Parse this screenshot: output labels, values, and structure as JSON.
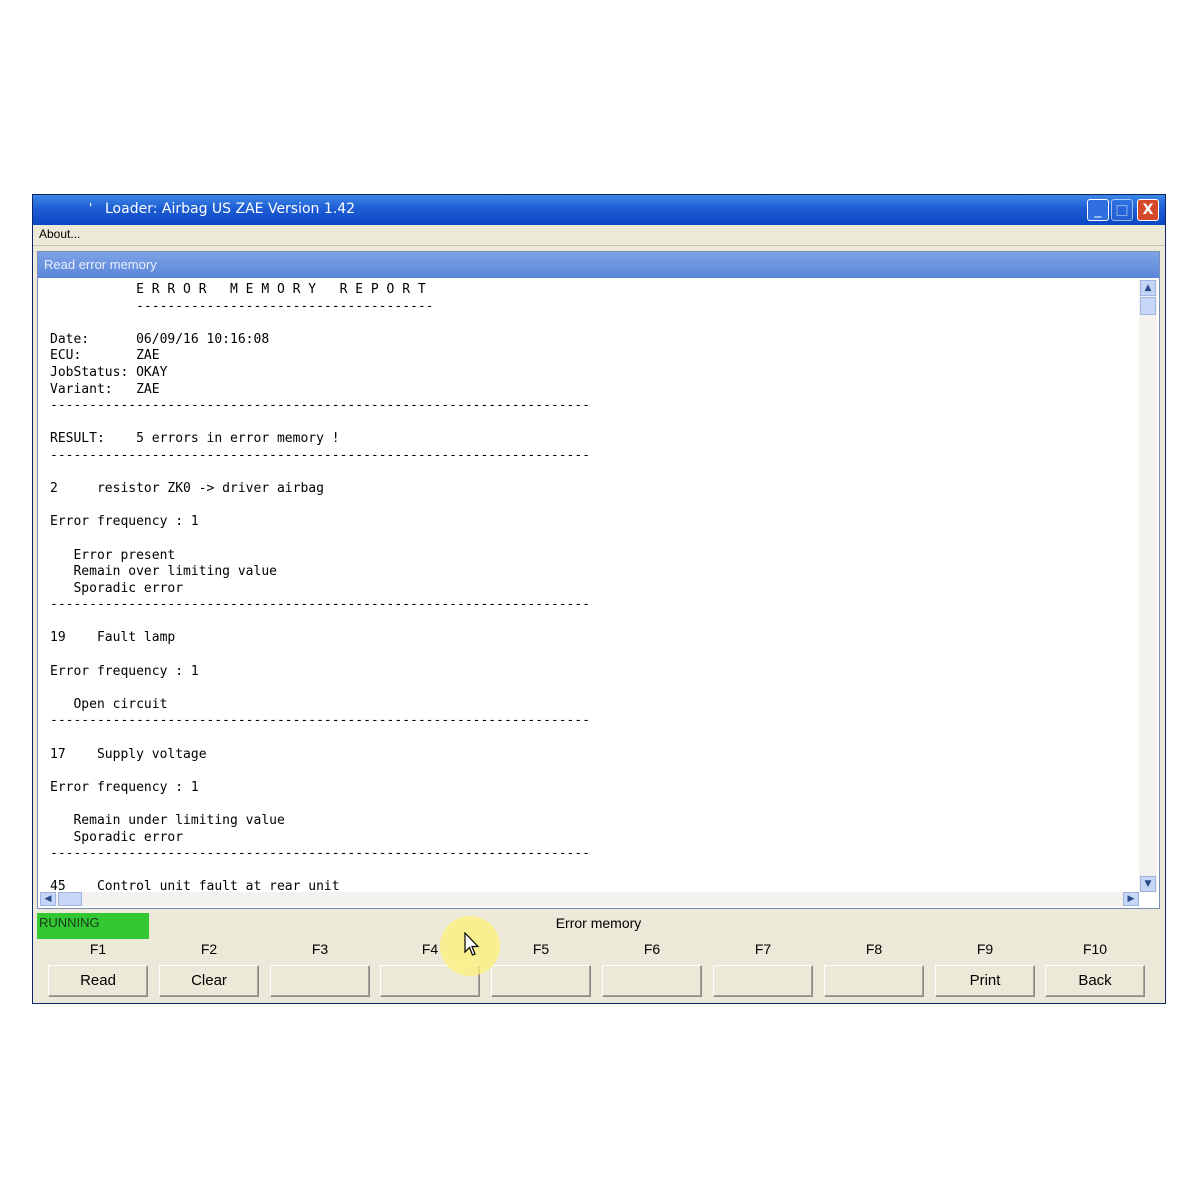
{
  "window": {
    "title": "Loader:  Airbag US ZAE Version 1.42",
    "title_prefix": "'",
    "minimize_glyph": "_",
    "maximize_glyph": "□",
    "close_glyph": "X"
  },
  "menu": {
    "about": "About..."
  },
  "panel": {
    "title": "Read error memory"
  },
  "report": {
    "heading": "E R R O R   M E M O R Y   R E P O R T",
    "heading_rule": "--------------------------------------",
    "date_label": "Date:",
    "date_value": "06/09/16 10:16:08",
    "ecu_label": "ECU:",
    "ecu_value": "ZAE",
    "jobstatus_label": "JobStatus:",
    "jobstatus_value": "OKAY",
    "variant_label": "Variant:",
    "variant_value": "ZAE",
    "rule": "---------------------------------------------------------------------",
    "result_label": "RESULT:",
    "result_value": "5 errors in error memory !",
    "errors": [
      {
        "code": "2",
        "name": "resistor ZK0 -> driver airbag",
        "frequency": "Error frequency : 1",
        "details": [
          "Error present",
          "Remain over limiting value",
          "Sporadic error"
        ]
      },
      {
        "code": "19",
        "name": "Fault lamp",
        "frequency": "Error frequency : 1",
        "details": [
          "Open circuit"
        ]
      },
      {
        "code": "17",
        "name": "Supply voltage",
        "frequency": "Error frequency : 1",
        "details": [
          "Remain under limiting value",
          "Sporadic error"
        ]
      }
    ],
    "cut_off_line": "45    Control unit fault at rear unit"
  },
  "status": {
    "running": "RUNNING",
    "label": "Error memory"
  },
  "fkeys": [
    {
      "key": "F1",
      "label": "Read"
    },
    {
      "key": "F2",
      "label": "Clear"
    },
    {
      "key": "F3",
      "label": ""
    },
    {
      "key": "F4",
      "label": ""
    },
    {
      "key": "F5",
      "label": ""
    },
    {
      "key": "F6",
      "label": ""
    },
    {
      "key": "F7",
      "label": ""
    },
    {
      "key": "F8",
      "label": ""
    },
    {
      "key": "F9",
      "label": "Print"
    },
    {
      "key": "F10",
      "label": "Back"
    }
  ],
  "colors": {
    "titlebar": "#0a49c4",
    "running": "#33c733",
    "panel_title": "#5a86d9"
  }
}
